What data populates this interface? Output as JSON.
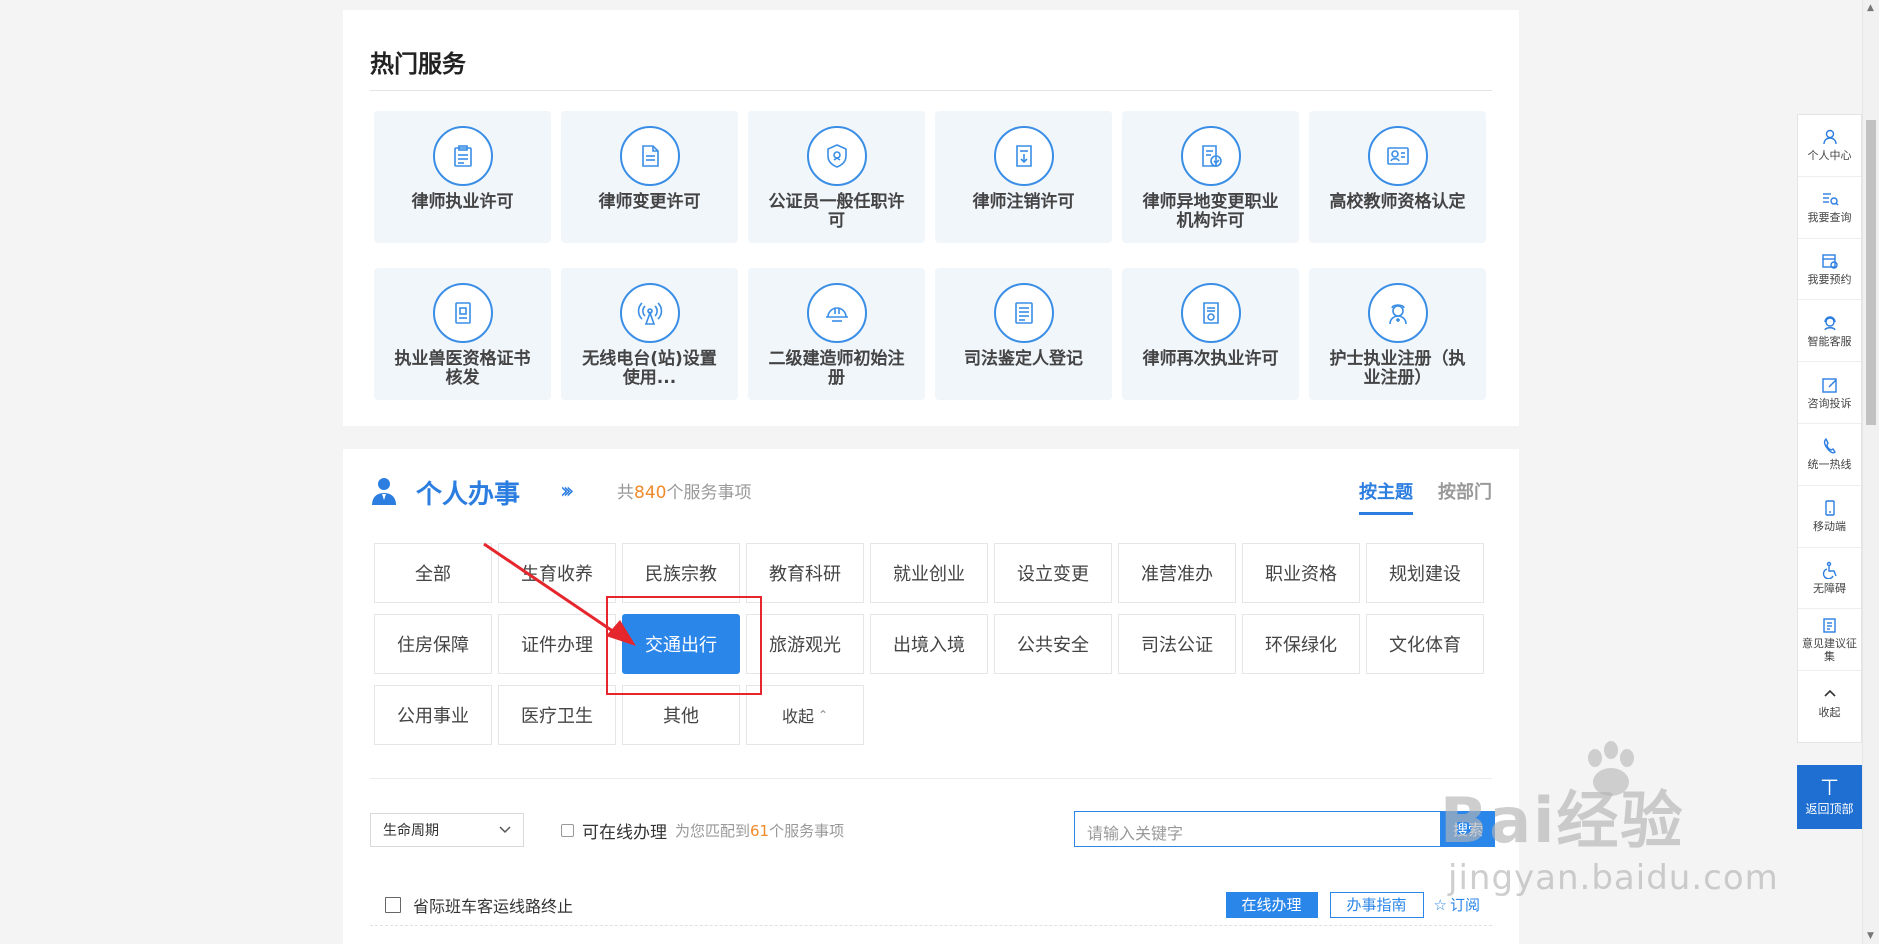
{
  "hot_services": {
    "title": "热门服务",
    "items": [
      {
        "label": "律师执业许可",
        "icon": "clipboard-icon"
      },
      {
        "label": "律师变更许可",
        "icon": "document-edit-icon"
      },
      {
        "label": "公证员一般任职许可",
        "icon": "shield-badge-icon"
      },
      {
        "label": "律师注销许可",
        "icon": "document-download-icon"
      },
      {
        "label": "律师异地变更职业机构许可",
        "icon": "document-check-icon"
      },
      {
        "label": "高校教师资格认定",
        "icon": "id-card-icon"
      },
      {
        "label": "执业兽医资格证书核发",
        "icon": "certificate-icon"
      },
      {
        "label": "无线电台(站)设置使用...",
        "icon": "radio-tower-icon"
      },
      {
        "label": "二级建造师初始注册",
        "icon": "hard-hat-icon"
      },
      {
        "label": "司法鉴定人登记",
        "icon": "register-book-icon"
      },
      {
        "label": "律师再次执业许可",
        "icon": "document-seal-icon"
      },
      {
        "label": "护士执业注册（执业注册）",
        "icon": "nurse-icon"
      }
    ]
  },
  "personal": {
    "title": "个人办事",
    "count_prefix": "共",
    "count": "840",
    "count_suffix": "个服务事项",
    "tab_theme": "按主题",
    "tab_dept": "按部门",
    "categories": [
      "全部",
      "生育收养",
      "民族宗教",
      "教育科研",
      "就业创业",
      "设立变更",
      "准营准办",
      "职业资格",
      "规划建设",
      "住房保障",
      "证件办理",
      "交通出行",
      "旅游观光",
      "出境入境",
      "公共安全",
      "司法公证",
      "环保绿化",
      "文化体育",
      "公用事业",
      "医疗卫生",
      "其他",
      "收起"
    ],
    "active_category": "交通出行",
    "filter_select": "生命周期",
    "online_label": "可在线办理",
    "match_prefix": "为您匹配到",
    "match_count": "61",
    "match_suffix": "个服务事项",
    "search_placeholder": "请输入关键字",
    "search_button": "搜索",
    "item_title": "省际班车客运线路终止",
    "btn_online": "在线办理",
    "btn_guide": "办事指南",
    "btn_subscribe": "订阅"
  },
  "sidebar": [
    {
      "label": "个人中心",
      "icon": "user-icon"
    },
    {
      "label": "我要查询",
      "icon": "query-icon"
    },
    {
      "label": "我要预约",
      "icon": "calendar-icon"
    },
    {
      "label": "智能客服",
      "icon": "customer-service-icon"
    },
    {
      "label": "咨询投诉",
      "icon": "edit-icon"
    },
    {
      "label": "统一热线",
      "icon": "phone-icon"
    },
    {
      "label": "移动端",
      "icon": "mobile-icon"
    },
    {
      "label": "无障碍",
      "icon": "accessibility-icon"
    },
    {
      "label": "意见建议征集",
      "icon": "feedback-icon"
    },
    {
      "label": "收起",
      "icon": "chevron-up-icon"
    }
  ],
  "back_top": "返回顶部",
  "watermark": {
    "brand": "Bai经验",
    "url": "jingyan.baidu.com"
  },
  "colors": {
    "accent": "#2b86ea",
    "highlight": "#e5262d",
    "count": "#f08a2b"
  }
}
